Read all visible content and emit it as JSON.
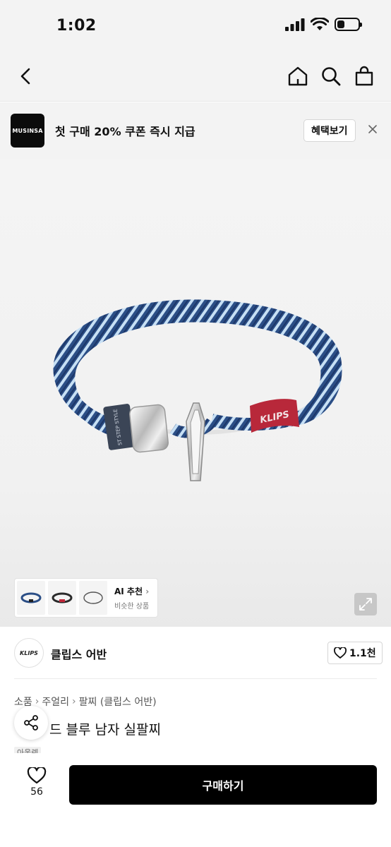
{
  "status_bar": {
    "time": "1:02",
    "battery_level": 0.35
  },
  "nav": {
    "back": "back-arrow-icon",
    "home": "home-icon",
    "search": "search-icon",
    "cart": "shopping-bag-icon"
  },
  "promo": {
    "logo_text": "MUSINSA",
    "text": "첫 구매 20% 쿠폰 즉시 지급",
    "button_label": "혜택보기",
    "close_icon": "close-icon"
  },
  "gallery": {
    "ai_title": "AI 추천",
    "ai_subtitle": "비슷한 상품",
    "expand_icon": "expand-icon",
    "bracelet_label": "KLIPS"
  },
  "brand": {
    "logo_text": "KLIPS",
    "name": "클립스 어반",
    "like_count": "1.1천"
  },
  "breadcrumb": [
    "소품",
    "주얼리",
    "팔찌 (클립스 어반)"
  ],
  "product": {
    "title": "드 블루 남자 실팔찌",
    "tag": "아울렛"
  },
  "bottom_bar": {
    "wish_count": "56",
    "buy_label": "구매하기"
  },
  "colors": {
    "background": "#f3f3f3",
    "buy_button": "#000000",
    "bracelet_navy": "#2b4e86",
    "bracelet_light": "#bfdcf4",
    "bracelet_red": "#b8283a"
  }
}
